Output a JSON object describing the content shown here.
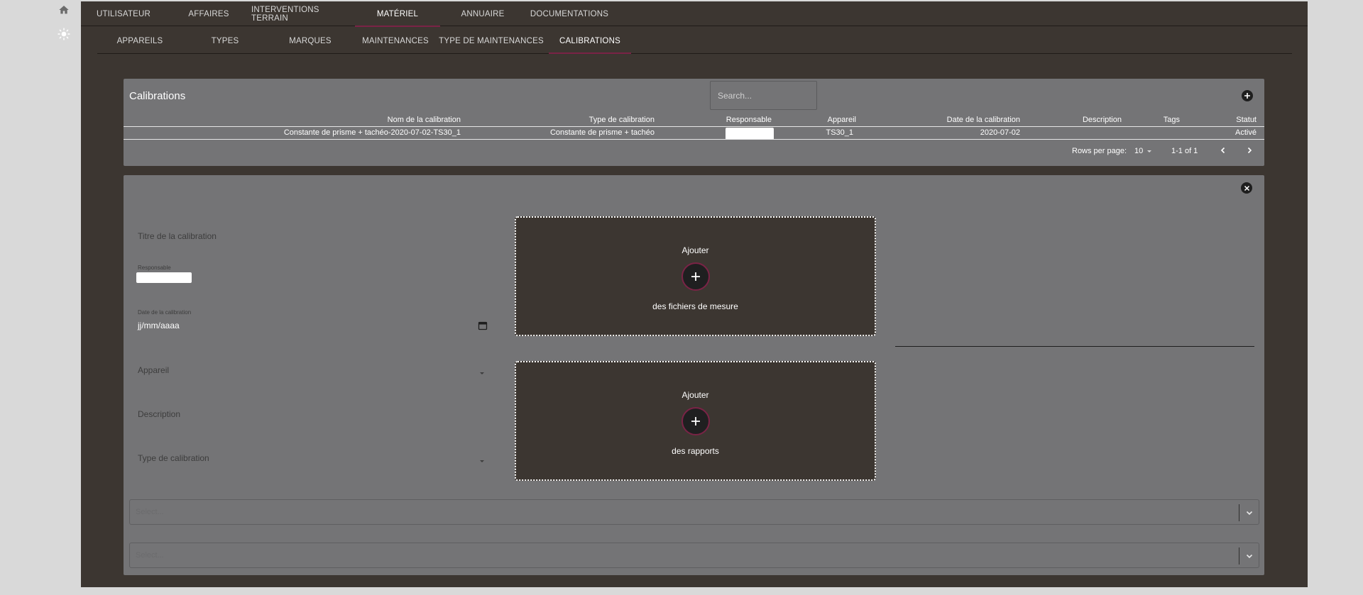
{
  "top_nav": {
    "tabs": [
      "UTILISATEUR",
      "AFFAIRES",
      "INTERVENTIONS TERRAIN",
      "MATÉRIEL",
      "ANNUAIRE",
      "DOCUMENTATIONS"
    ],
    "active": "MATÉRIEL"
  },
  "sub_nav": {
    "tabs": [
      "APPAREILS",
      "TYPES",
      "MARQUES",
      "MAINTENANCES",
      "TYPE DE MAINTENANCES",
      "CALIBRATIONS"
    ],
    "active": "CALIBRATIONS"
  },
  "list": {
    "title": "Calibrations",
    "search_placeholder": "Search...",
    "columns": [
      "Nom de la calibration",
      "Type de calibration",
      "Responsable",
      "Appareil",
      "Date de la calibration",
      "Description",
      "Tags",
      "Statut"
    ],
    "rows": [
      {
        "nom": "Constante de prisme + tachéo-2020-07-02-TS30_1",
        "type": "Constante de prisme + tachéo",
        "responsable": "",
        "appareil": "TS30_1",
        "date": "2020-07-02",
        "description": "",
        "tags": "",
        "statut": "Activé"
      }
    ],
    "pagination": {
      "rows_per_page_label": "Rows per page:",
      "rows_per_page_value": "10",
      "range": "1-1 of 1"
    }
  },
  "form": {
    "titre_label": "Titre de la calibration",
    "responsable_label": "Responsable",
    "date_label": "Date de la calibration",
    "date_value": "jj/mm/aaaa",
    "appareil_label": "Appareil",
    "description_label": "Description",
    "type_label": "Type de calibration",
    "dropzone_mesure": {
      "top": "Ajouter",
      "bottom": "des fichiers de mesure"
    },
    "dropzone_rapports": {
      "top": "Ajouter",
      "bottom": "des rapports"
    },
    "select1_placeholder": "Select...",
    "select2_placeholder": "Select..."
  },
  "icons": {
    "home": "home-icon",
    "theme": "sun-icon"
  },
  "colors": {
    "app_bg": "#3c3631",
    "card_bg": "#747476",
    "accent": "#7a2346"
  }
}
